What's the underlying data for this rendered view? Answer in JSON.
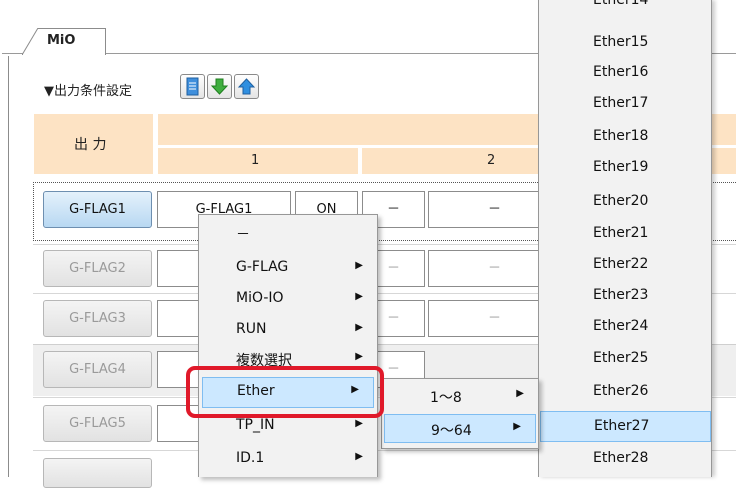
{
  "tab": {
    "label": "MiO"
  },
  "section": {
    "title": "▼出力条件設定"
  },
  "toolbar": {
    "icons": [
      "document-icon",
      "arrow-down-icon",
      "arrow-up-icon"
    ]
  },
  "table": {
    "header_left": "出 力",
    "columns": [
      "1",
      "2"
    ],
    "rows": [
      {
        "flag": "G-FLAG1",
        "cell1": "G-FLAG1",
        "cell2": "ON",
        "cell3": "－",
        "cell4": "－"
      },
      {
        "flag": "G-FLAG2",
        "cell3": "－",
        "cell4": "－"
      },
      {
        "flag": "G-FLAG3",
        "cell3": "－",
        "cell4": "－"
      },
      {
        "flag": "G-FLAG4",
        "cell3": "－",
        "cell4": "－"
      },
      {
        "flag": "G-FLAG5"
      }
    ]
  },
  "context_menu": {
    "items": [
      {
        "label": "－"
      },
      {
        "label": "G-FLAG",
        "arrow": "▶"
      },
      {
        "label": "MiO-IO",
        "arrow": "▶"
      },
      {
        "label": "RUN",
        "arrow": "▶"
      },
      {
        "label": "複数選択",
        "arrow": "▶"
      },
      {
        "label": "Ether",
        "arrow": "▶"
      },
      {
        "label": "TP_IN",
        "arrow": "▶"
      },
      {
        "label": "ID.1",
        "arrow": "▶"
      }
    ]
  },
  "ether_submenu": {
    "items": [
      {
        "label": "1～8",
        "arrow": "▶"
      },
      {
        "label": "9～64",
        "arrow": "▶"
      }
    ]
  },
  "ether_list": {
    "items": [
      "Ether14",
      "Ether15",
      "Ether16",
      "Ether17",
      "Ether18",
      "Ether19",
      "Ether20",
      "Ether21",
      "Ether22",
      "Ether23",
      "Ether24",
      "Ether25",
      "Ether26",
      "Ether27",
      "Ether28"
    ],
    "selected": "Ether27"
  },
  "colors": {
    "header_bg": "#fde3c4",
    "highlight_border": "#e0192a",
    "menu_selection": "#cce8ff"
  }
}
